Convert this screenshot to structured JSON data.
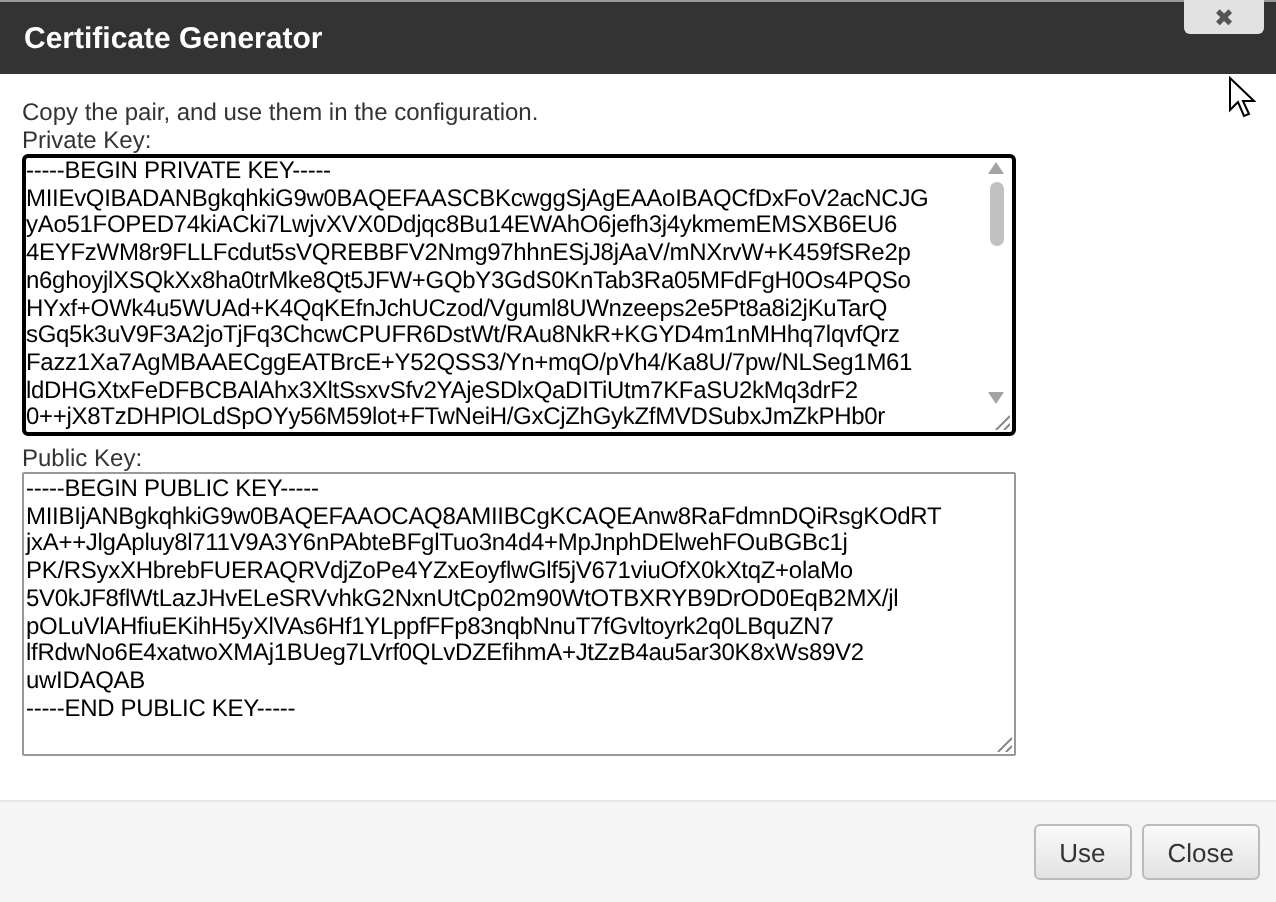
{
  "dialog": {
    "title": "Certificate Generator",
    "close_glyph": "✖"
  },
  "instructions": "Copy the pair, and use them in the configuration.",
  "private_key": {
    "label": "Private Key:",
    "focused": true,
    "lines": [
      "-----BEGIN PRIVATE KEY-----",
      "MIIEvQIBADANBgkqhkiG9w0BAQEFAASCBKcwggSjAgEAAoIBAQCfDxFoV2acNCJG",
      "yAo51FOPED74kiACki7LwjvXVX0Ddjqc8Bu14EWAhO6jefh3j4ykmemEMSXB6EU6",
      "4EYFzWM8r9FLLFcdut5sVQREBBFV2Nmg97hhnESjJ8jAaV/mNXrvW+K459fSRe2p",
      "n6ghoyjlXSQkXx8ha0trMke8Qt5JFW+GQbY3GdS0KnTab3Ra05MFdFgH0Os4PQSo",
      "HYxf+OWk4u5WUAd+K4QqKEfnJchUCzod/Vguml8UWnzeeps2e5Pt8a8i2jKuTarQ",
      "sGq5k3uV9F3A2joTjFq3ChcwCPUFR6DstWt/RAu8NkR+KGYD4m1nMHhq7lqvfQrz",
      "Fazz1Xa7AgMBAAECggEATBrcE+Y52QSS3/Yn+mqO/pVh4/Ka8U/7pw/NLSeg1M61",
      "ldDHGXtxFeDFBCBAlAhx3XltSsxvSfv2YAjeSDlxQaDITiUtm7KFaSU2kMq3drF2",
      "0++jX8TzDHPlOLdSpOYy56M59lot+FTwNeiH/GxCjZhGykZfMVDSubxJmZkPHb0r"
    ]
  },
  "public_key": {
    "label": "Public Key:",
    "focused": false,
    "lines": [
      "-----BEGIN PUBLIC KEY-----",
      "MIIBIjANBgkqhkiG9w0BAQEFAAOCAQ8AMIIBCgKCAQEAnw8RaFdmnDQiRsgKOdRT",
      "jxA++JlgApluy8l711V9A3Y6nPAbteBFglTuo3n4d4+MpJnphDElwehFOuBGBc1j",
      "PK/RSyxXHbrebFUERAQRVdjZoPe4YZxEoyflwGlf5jV671viuOfX0kXtqZ+olaMo",
      "5V0kJF8flWtLazJHvELeSRVvhkG2NxnUtCp02m90WtOTBXRYB9DrOD0EqB2MX/jl",
      "pOLuVlAHfiuEKihH5yXlVAs6Hf1YLppfFFp83nqbNnuT7fGvltoyrk2q0LBquZN7",
      "lfRdwNo6E4xatwoXMAj1BUeg7LVrf0QLvDZEfihmA+JtZzB4au5ar30K8xWs89V2",
      "uwIDAQAB",
      "-----END PUBLIC KEY-----"
    ]
  },
  "buttons": [
    {
      "label": "Use"
    },
    {
      "label": "Close"
    }
  ]
}
